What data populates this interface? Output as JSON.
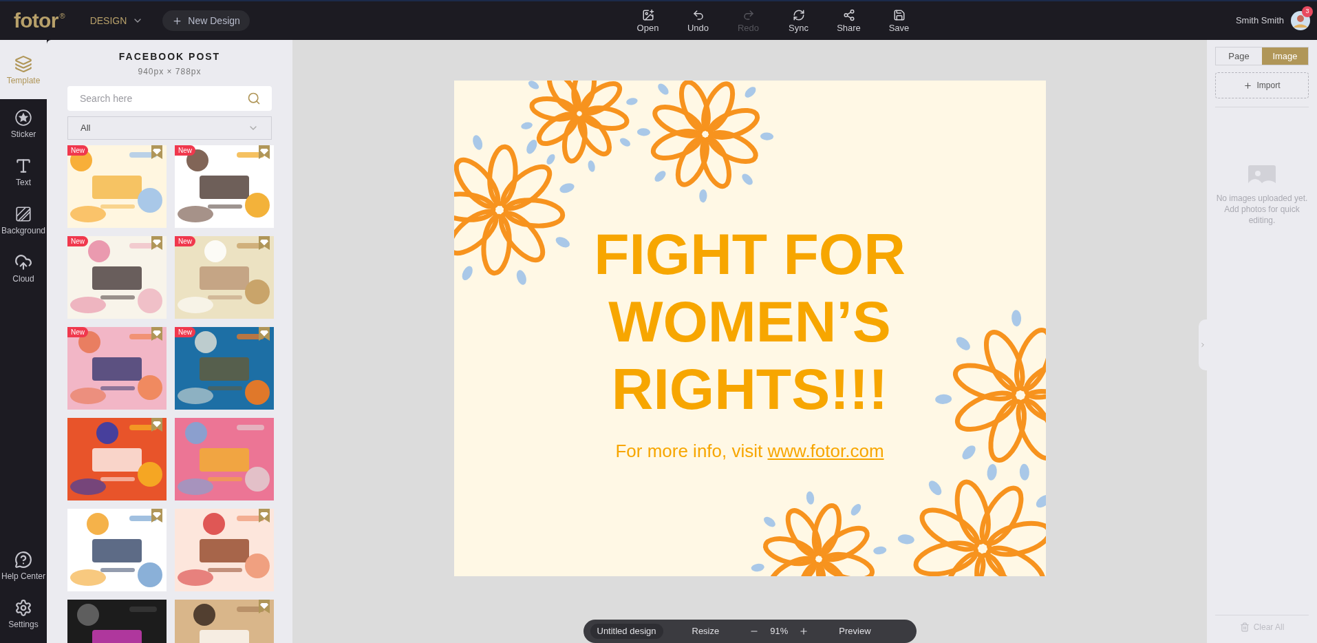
{
  "topbar": {
    "logo": "fotor",
    "logo_mark": "®",
    "menu": "DESIGN",
    "new_design": "New Design",
    "tools": [
      {
        "label": "Open",
        "disabled": false
      },
      {
        "label": "Undo",
        "disabled": false
      },
      {
        "label": "Redo",
        "disabled": true
      },
      {
        "label": "Sync",
        "disabled": false
      },
      {
        "label": "Share",
        "disabled": false
      },
      {
        "label": "Save",
        "disabled": false
      }
    ],
    "user": "Smith Smith",
    "notifications": "3"
  },
  "rail": {
    "items": [
      {
        "label": "Template",
        "selected": true
      },
      {
        "label": "Sticker",
        "selected": false
      },
      {
        "label": "Text",
        "selected": false
      },
      {
        "label": "Background",
        "selected": false
      },
      {
        "label": "Cloud",
        "selected": false
      }
    ],
    "bottom_items": [
      {
        "label": "Help Center"
      },
      {
        "label": "Settings"
      }
    ]
  },
  "panel": {
    "title": "FACEBOOK POST",
    "size": "940px × 788px",
    "search": {
      "placeholder": "Search here"
    },
    "filter": "All",
    "templates": [
      {
        "kind": "picture",
        "badge": "New",
        "premium": true
      },
      {
        "kind": "picture",
        "badge": "New",
        "premium": true
      },
      {
        "kind": "picture",
        "badge": "New",
        "premium": true
      },
      {
        "kind": "picture",
        "badge": "New",
        "premium": true
      },
      {
        "kind": "picture",
        "badge": "New",
        "premium": true
      },
      {
        "kind": "picture",
        "badge": "New",
        "premium": true
      },
      {
        "kind": "picture",
        "premium": true
      },
      {
        "kind": "picture",
        "premium": false
      },
      {
        "kind": "picture",
        "premium": true
      },
      {
        "kind": "picture",
        "premium": true
      },
      {
        "kind": "picture",
        "premium": false
      },
      {
        "kind": "picture",
        "premium": true
      }
    ]
  },
  "canvas": {
    "headline": "FIGHT FOR WOMEN’S RIGHTS!!!",
    "subtitle": "For more info, visit",
    "link": "www.fotor.com"
  },
  "bottom_bar": {
    "design_name": "Untitled design",
    "resize": "Resize",
    "zoom": "91%",
    "preview": "Preview"
  },
  "right_panel": {
    "tabs": [
      {
        "label": "Page",
        "selected": false
      },
      {
        "label": "Image",
        "selected": true
      }
    ],
    "import": "Import",
    "empty_message": "No images uploaded yet. Add photos for quick editing.",
    "clear_all": "Clear All"
  }
}
